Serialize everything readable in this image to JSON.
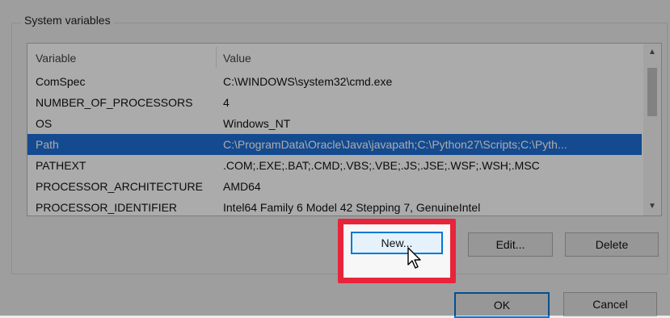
{
  "group": {
    "label": "System variables"
  },
  "table": {
    "headers": [
      "Variable",
      "Value"
    ],
    "rows": [
      {
        "variable": "ComSpec",
        "value": "C:\\WINDOWS\\system32\\cmd.exe"
      },
      {
        "variable": "NUMBER_OF_PROCESSORS",
        "value": "4"
      },
      {
        "variable": "OS",
        "value": "Windows_NT"
      },
      {
        "variable": "Path",
        "value": "C:\\ProgramData\\Oracle\\Java\\javapath;C:\\Python27\\Scripts;C:\\Pyth..."
      },
      {
        "variable": "PATHEXT",
        "value": ".COM;.EXE;.BAT;.CMD;.VBS;.VBE;.JS;.JSE;.WSF;.WSH;.MSC"
      },
      {
        "variable": "PROCESSOR_ARCHITECTURE",
        "value": "AMD64"
      },
      {
        "variable": "PROCESSOR_IDENTIFIER",
        "value": "Intel64 Family 6 Model 42 Stepping 7, GenuineIntel"
      }
    ],
    "selected_index": 3
  },
  "buttons": {
    "new": "New...",
    "edit": "Edit...",
    "delete": "Delete",
    "ok": "OK",
    "cancel": "Cancel"
  },
  "colors": {
    "selection": "#1f6fd6",
    "highlight_box": "#e8243a",
    "focus_border": "#0078d7"
  },
  "icons": {
    "scroll_up": "scroll-up-arrow-icon",
    "scroll_down": "scroll-down-arrow-icon",
    "cursor": "mouse-pointer-icon"
  }
}
